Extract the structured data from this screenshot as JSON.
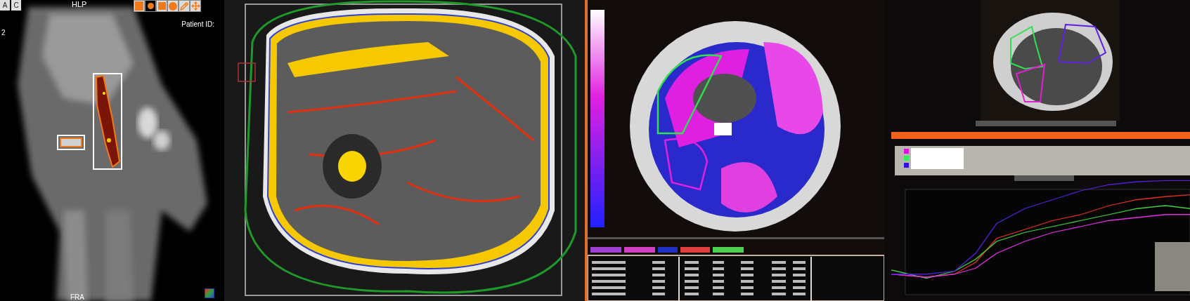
{
  "hand_viewer": {
    "view_buttons": [
      {
        "label": "A"
      },
      {
        "label": "C"
      }
    ],
    "orientation_top": "HLP",
    "tools": [
      {
        "kind": "fill",
        "selected": false
      },
      {
        "kind": "dot",
        "selected": true
      },
      {
        "kind": "square",
        "selected": false
      },
      {
        "kind": "circle",
        "selected": false
      },
      {
        "kind": "pen",
        "selected": false
      },
      {
        "kind": "move",
        "selected": false
      }
    ],
    "patient_id_label": "Patient ID:",
    "slice_number": "2",
    "orientation_bottom": "FRA"
  }
}
